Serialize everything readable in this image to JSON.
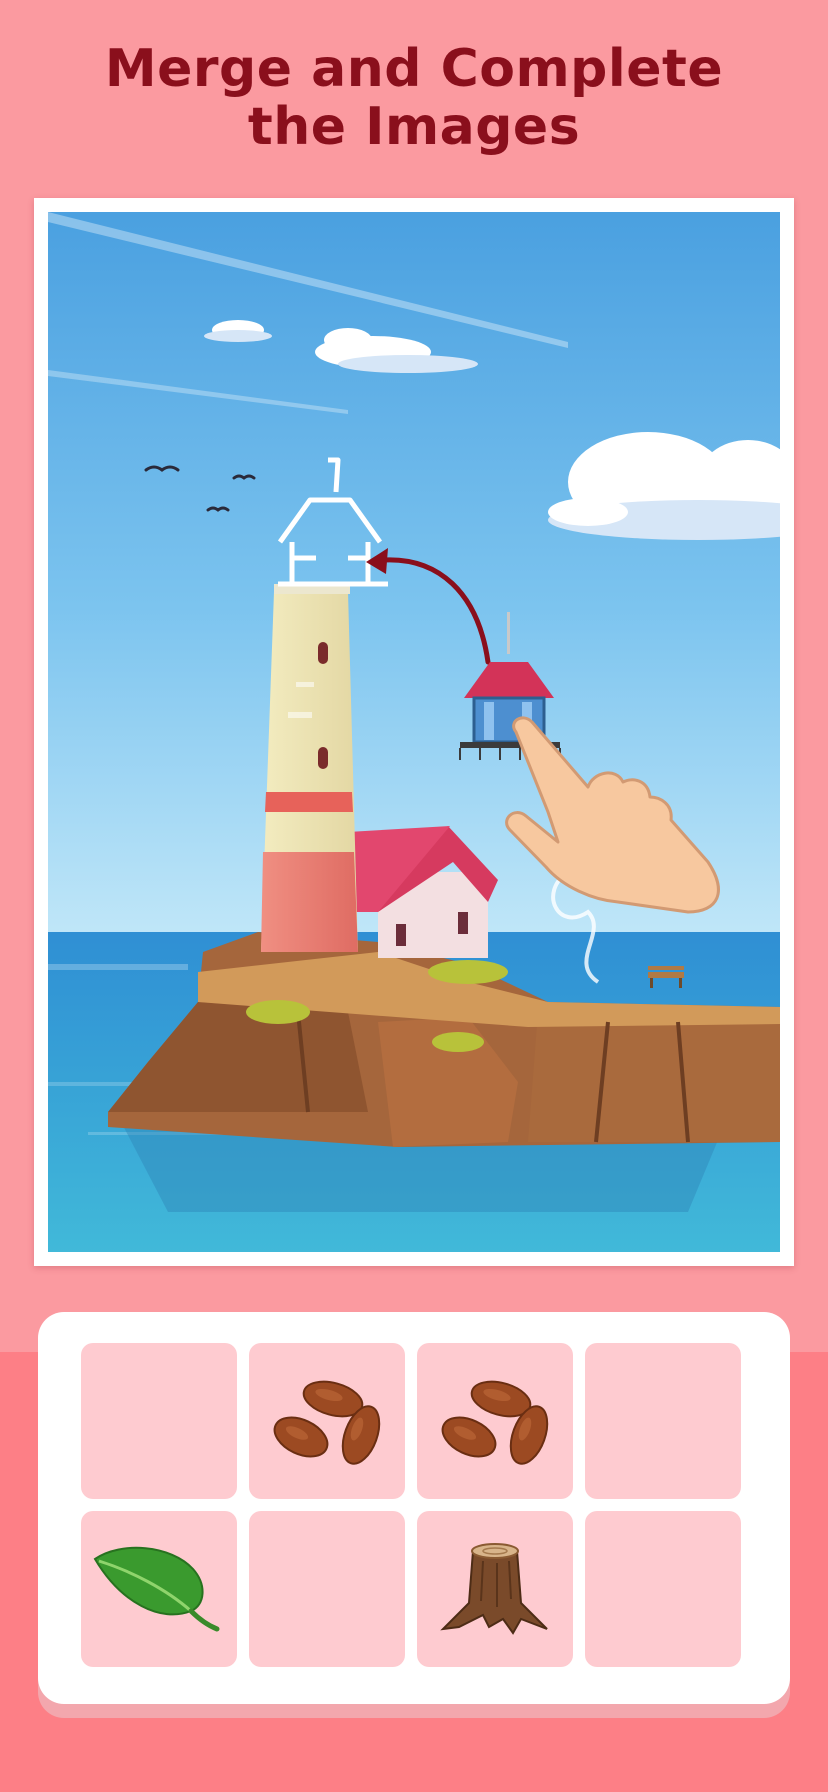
{
  "headline": {
    "line1": "Merge and Complete",
    "line2": "the Images"
  },
  "colors": {
    "background": "#fb9aa0",
    "bottom_band": "#fd7f86",
    "headline": "#8a0f1c",
    "cell": "#fecbd0",
    "tray": "#ffffff"
  },
  "scene": {
    "subject": "lighthouse-on-rocky-island",
    "hint": "drag-lighthouse-top-to-outline"
  },
  "merge_board": {
    "rows": 2,
    "columns": 4,
    "cells": [
      {
        "item": null
      },
      {
        "item": "almonds-icon"
      },
      {
        "item": "almonds-icon"
      },
      {
        "item": null
      },
      {
        "item": "leaf-icon"
      },
      {
        "item": null
      },
      {
        "item": "tree-stump-icon"
      },
      {
        "item": null
      }
    ]
  }
}
